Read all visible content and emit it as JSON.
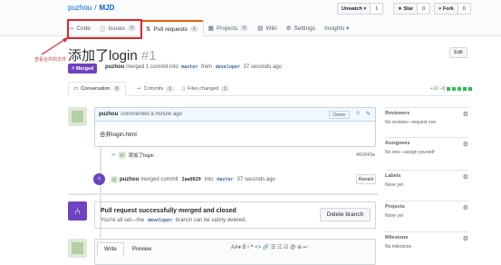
{
  "repo": {
    "owner": "puzhou",
    "name": "MJD"
  },
  "actions": {
    "watch": {
      "label": "Unwatch ▾",
      "count": "1"
    },
    "star": {
      "label": "★ Star",
      "count": "0"
    },
    "fork": {
      "label": "Fork",
      "count": "0"
    }
  },
  "tabs": [
    {
      "label": "Code",
      "count": ""
    },
    {
      "label": "Issues",
      "count": "0"
    },
    {
      "label": "Pull requests",
      "count": "1"
    },
    {
      "label": "Projects",
      "count": "0"
    },
    {
      "label": "Wiki",
      "count": ""
    },
    {
      "label": "Settings",
      "count": ""
    },
    {
      "label": "Insights ▾",
      "count": ""
    }
  ],
  "annotation": "查看合并的文件",
  "pr": {
    "title": "添加了login",
    "number": "#1",
    "status": "Merged",
    "author": "puzhou",
    "meta1": "merged 1 commit into",
    "base": "master",
    "meta2": "from",
    "head": "developer",
    "time": "37 seconds ago",
    "edit": "Edit"
  },
  "pr_tabs": [
    {
      "label": "Conversation",
      "count": "0"
    },
    {
      "label": "Commits",
      "count": "1"
    },
    {
      "label": "Files changed",
      "count": "1"
    }
  ],
  "diffstat": {
    "add": "+10",
    "del": "−0"
  },
  "comment": {
    "author": "puzhou",
    "time": "commented a minute ago",
    "owner": "Owner",
    "body": "合并login.html"
  },
  "commit": {
    "message": "添加了login",
    "sha": "402043e"
  },
  "merge_event": {
    "author": "puzhou",
    "text": "merged commit",
    "sha": "2aa9829",
    "into": "into",
    "base": "master",
    "time": "37 seconds ago",
    "revert": "Revert"
  },
  "merge_box": {
    "title": "Pull request successfully merged and closed",
    "sub1": "You're all set—the",
    "branch": "developer",
    "sub2": "branch can be safely deleted.",
    "button": "Delete branch"
  },
  "write": {
    "write": "Write",
    "preview": "Preview",
    "toolbar": "AA▾  B  i  ❝  <>  🔗  ☰  ☷  ☑  @  ⊕  ↩"
  },
  "sidebar": [
    {
      "heading": "Reviewers",
      "value": "No reviews—request one"
    },
    {
      "heading": "Assignees",
      "value": "No one—assign yourself"
    },
    {
      "heading": "Labels",
      "value": "None yet"
    },
    {
      "heading": "Projects",
      "value": "None yet"
    },
    {
      "heading": "Milestone",
      "value": "No milestone"
    }
  ]
}
